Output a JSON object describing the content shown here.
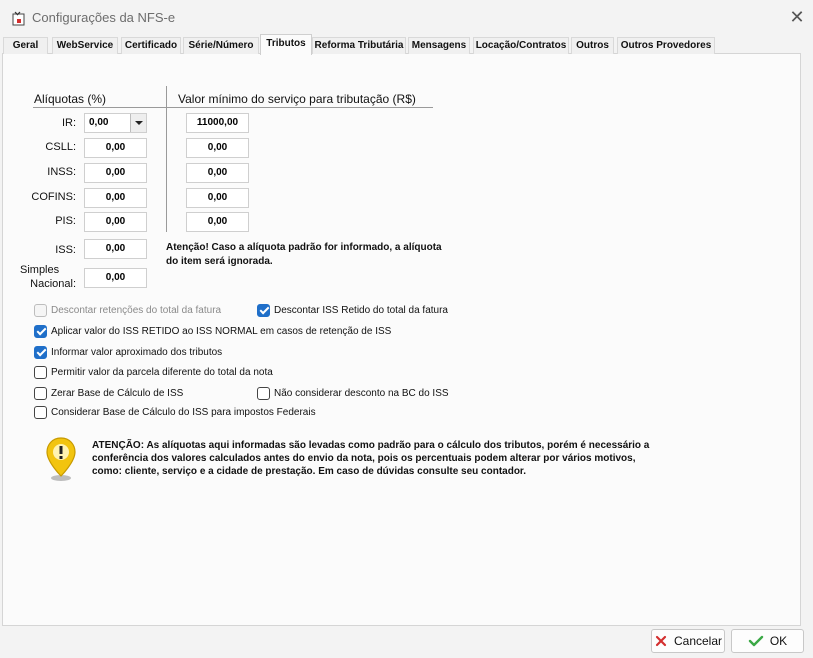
{
  "window": {
    "title": "Configurações da NFS-e",
    "close_glyph": "✕"
  },
  "tabs": [
    {
      "label": "Geral"
    },
    {
      "label": "WebService"
    },
    {
      "label": "Certificado"
    },
    {
      "label": "Série/Número"
    },
    {
      "label": "Tributos",
      "active": true
    },
    {
      "label": "Reforma Tributária"
    },
    {
      "label": "Mensagens"
    },
    {
      "label": "Locação/Contratos"
    },
    {
      "label": "Outros"
    },
    {
      "label": "Outros Provedores"
    }
  ],
  "aliquotas": {
    "heading": "Alíquotas (%)",
    "min_heading": "Valor mínimo do serviço para tributação (R$)",
    "rows": [
      {
        "label": "IR:",
        "value": "0,00",
        "min": "11000,00"
      },
      {
        "label": "CSLL:",
        "value": "0,00",
        "min": "0,00"
      },
      {
        "label": "INSS:",
        "value": "0,00",
        "min": "0,00"
      },
      {
        "label": "COFINS:",
        "value": "0,00",
        "min": "0,00"
      },
      {
        "label": "PIS:",
        "value": "0,00",
        "min": "0,00"
      }
    ],
    "iss": {
      "label": "ISS:",
      "value": "0,00"
    },
    "simples": {
      "label_line1": "Simples",
      "label_line2": "Nacional:",
      "value": "0,00"
    },
    "iss_note_line1": "Atenção!  Caso a alíquota padrão for informado, a alíquota",
    "iss_note_line2": "do item será ignorada."
  },
  "options": {
    "descontar_retencoes": {
      "label": "Descontar retenções do total da fatura",
      "checked": false,
      "disabled": true
    },
    "descontar_iss_retido": {
      "label": "Descontar ISS Retido do total da fatura",
      "checked": true
    },
    "aplicar_iss_retido": {
      "label": "Aplicar valor do ISS RETIDO ao ISS NORMAL em casos de retenção de ISS",
      "checked": true
    },
    "informar_aproximado": {
      "label": "Informar valor aproximado dos tributos",
      "checked": true
    },
    "permitir_parcela": {
      "label": "Permitir valor da parcela diferente do total da nota",
      "checked": false
    },
    "zerar_base": {
      "label": "Zerar Base de Cálculo de ISS",
      "checked": false
    },
    "nao_considerar_desconto": {
      "label": "Não considerar desconto na BC do ISS",
      "checked": false
    },
    "considerar_base_federais": {
      "label": "Considerar Base de Cálculo do ISS para impostos Federais",
      "checked": false
    }
  },
  "warning": {
    "icon": "warning-pin-icon",
    "line1": "ATENÇÃO: As alíquotas aqui informadas são levadas como padrão para o cálculo dos tributos, porém é  necessário a",
    "line2": "conferência dos valores calculados antes do envio da nota,  pois os percentuais podem alterar por vários motivos,",
    "line3": "como: cliente, serviço e a cidade de prestação.  Em caso de dúvidas consulte seu contador."
  },
  "buttons": {
    "cancel_label": "Cancelar",
    "ok_label": "OK"
  },
  "colors": {
    "accent": "#1f6fc9",
    "cancel_red": "#d32f2f",
    "ok_green": "#3aa845"
  }
}
